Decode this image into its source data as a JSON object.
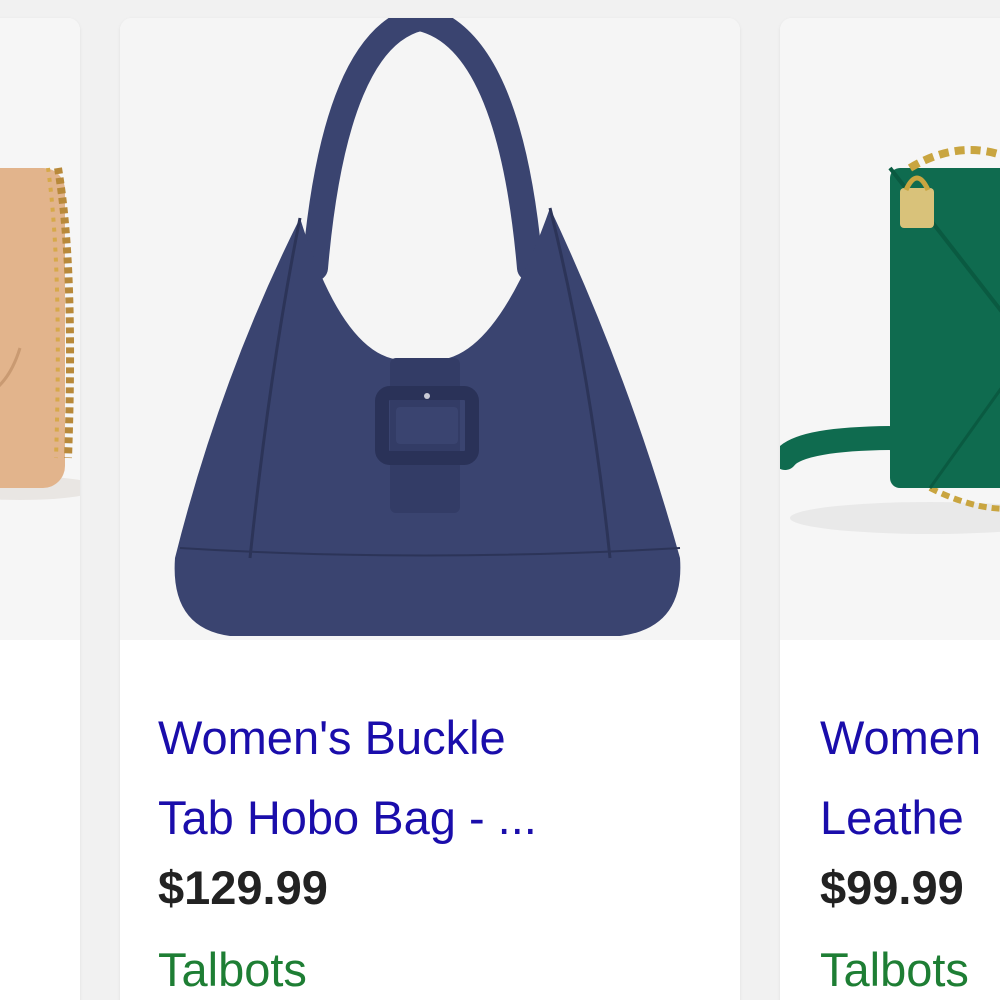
{
  "products": [
    {
      "image_alt": "",
      "color": "#e2b48c"
    },
    {
      "title_line1": "Women's Buckle",
      "title_line2": "Tab Hobo Bag - ...",
      "price": "$129.99",
      "merchant": "Talbots",
      "color": "#3a4470"
    },
    {
      "title_line1": "Women",
      "title_line2": "Leathe",
      "price": "$99.99",
      "merchant": "Talbots",
      "color": "#0f6b4f"
    }
  ],
  "colors": {
    "title_link": "#1a0dab",
    "price": "#222222",
    "merchant": "#1e7e34"
  },
  "icons": {
    "product_images": "handbag-photo"
  }
}
